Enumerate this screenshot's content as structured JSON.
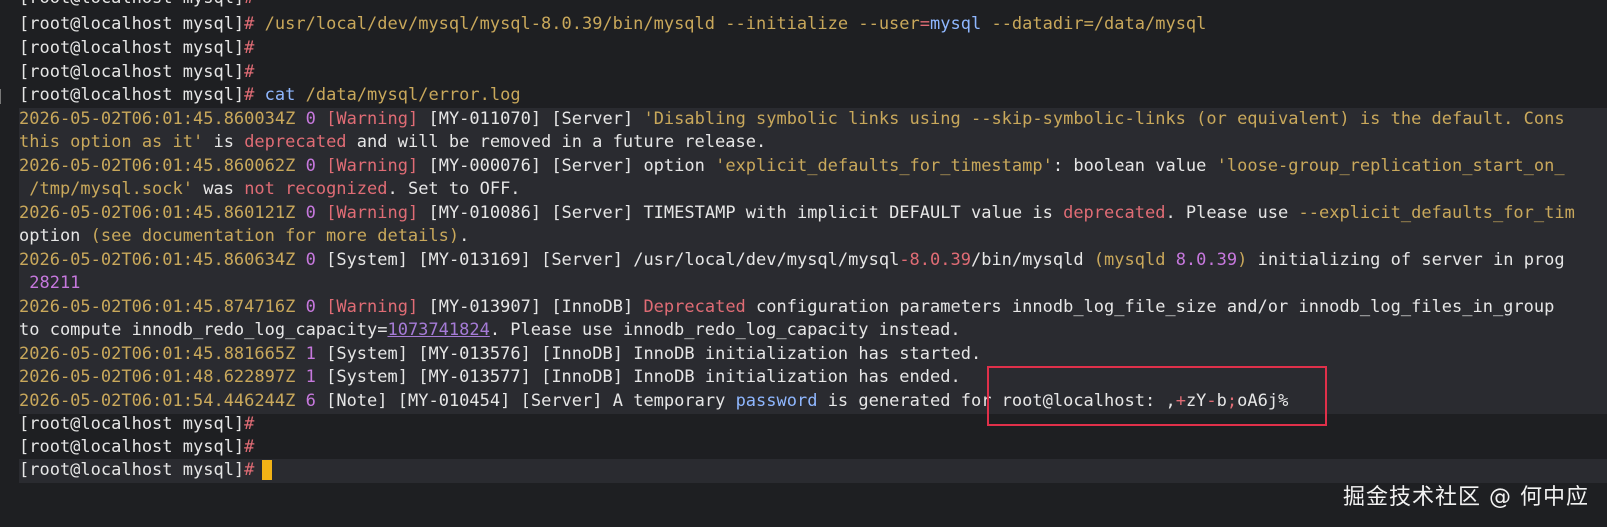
{
  "prompt": "[root@localhost mysql]",
  "hash": "#",
  "lines": {
    "l0": "[root@localhost mysql]",
    "init_cmd": "/usr/local/dev/mysql/mysql-8.0.39/bin/mysqld",
    "init_opt1": "--initialize",
    "init_opt2": "--user",
    "init_eq": "=",
    "init_user": "mysql",
    "init_opt3": "--datadir",
    "init_dir": "=/data/mysql",
    "cat_cmd": "cat",
    "cat_arg": "/data/mysql/error.log",
    "log1a": "2026-05-02T06:01:45.860034Z",
    "log1b": "0",
    "log1c": "[Warning]",
    "log1d": "[MY-011070]",
    "log1e": "[Server]",
    "log1f": "'Disabling symbolic links using --skip-symbolic-links (or equivalent) is the default. Cons",
    "log1g": "this option as it'",
    "log1h": " is ",
    "log1i": "deprecated",
    "log1j": " and will be removed in a future release.",
    "log2a": "2026-05-02T06:01:45.860062Z",
    "log2b": "0",
    "log2c": "[Warning]",
    "log2d": "[MY-000076]",
    "log2e": "[Server]",
    "log2f": " option ",
    "log2g": "'explicit_defaults_for_timestamp'",
    "log2h": ": boolean value ",
    "log2i": "'loose-group_replication_start_on_",
    "log2j": " /tmp/mysql.sock'",
    "log2k": " was ",
    "log2l": "not recognized",
    "log2m": ". Set to OFF.",
    "log3a": "2026-05-02T06:01:45.860121Z",
    "log3b": "0",
    "log3c": "[Warning]",
    "log3d": "[MY-010086]",
    "log3e": "[Server]",
    "log3f": " TIMESTAMP with implicit DEFAULT value is ",
    "log3g": "deprecated",
    "log3h": ". Please use ",
    "log3i": "--explicit_defaults_for_tim",
    "log3j": "option ",
    "log3k": "(see documentation for more details)",
    "log3l": ".",
    "log4a": "2026-05-02T06:01:45.860634Z",
    "log4b": "0",
    "log4c": "[System]",
    "log4d": "[MY-013169]",
    "log4e": "[Server]",
    "log4f": " /usr/local/dev/mysql/mysql",
    "log4g": "-8.0.39",
    "log4h": "/bin/mysqld ",
    "log4i": "(mysqld ",
    "log4j": "8.0.39",
    "log4k": ")",
    "log4l": " initializing of server in prog",
    "log4m": " 28211",
    "log5a": "2026-05-02T06:01:45.874716Z",
    "log5b": "0",
    "log5c": "[Warning]",
    "log5d": "[MY-013907]",
    "log5e": "[InnoDB]",
    "log5f": " Deprecated",
    "log5g": " configuration parameters innodb_log_file_size and/or innodb_log_files_in_group ",
    "log5h": "to compute innodb_redo_log_capacity=",
    "log5i": "1073741824",
    "log5j": ". Please use innodb_redo_log_capacity instead.",
    "log6a": "2026-05-02T06:01:45.881665Z",
    "log6b": "1",
    "log6c": "[System]",
    "log6d": "[MY-013576]",
    "log6e": "[InnoDB]",
    "log6f": " InnoDB initialization has started.",
    "log7a": "2026-05-02T06:01:48.622897Z",
    "log7b": "1",
    "log7c": "[System]",
    "log7d": "[MY-013577]",
    "log7e": "[InnoDB]",
    "log7f": " InnoDB initialization has ended.",
    "log8a": "2026-05-02T06:01:54.446244Z",
    "log8b": "6",
    "log8c": "[Note]",
    "log8d": "[MY-010454]",
    "log8e": "[Server]",
    "log8f": " A temporary ",
    "log8g": "password",
    "log8h": " is generated for root@localhost",
    "log8i": ": ,",
    "log8j": "+",
    "log8k": "zY",
    "log8l": "-",
    "log8m": "b",
    "log8n": ";",
    "log8o": "oA6j%"
  },
  "watermark": "掘金技术社区 @ 何中应",
  "colors": {
    "cursor": "#f2b316",
    "highlight_box": "#e0304a",
    "background": "#1e1f22"
  }
}
